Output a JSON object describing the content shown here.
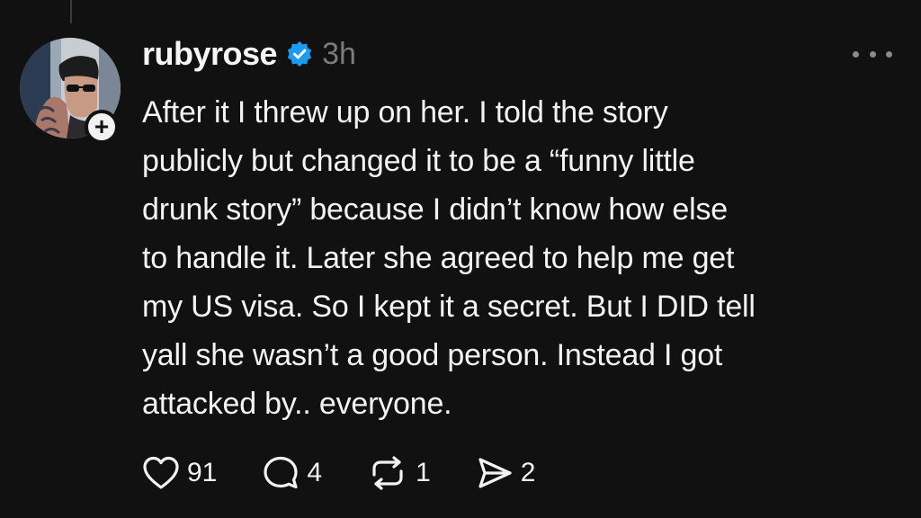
{
  "post": {
    "username": "rubyrose",
    "verified": true,
    "time": "3h",
    "body_lines": [
      "After it I threw up on her. I told the story",
      "publicly but changed it to be a “funny little",
      "drunk story” because I didn’t know how else",
      "to handle it. Later she agreed to help me get",
      "my US visa. So I kept it a secret. But I DID tell",
      "yall she wasn’t a good person. Instead I got",
      "attacked by.. everyone."
    ],
    "actions": {
      "likes": "91",
      "replies": "4",
      "reposts": "1",
      "shares": "2"
    }
  },
  "icons": {
    "add": "plus-icon",
    "verified": "verified-badge-icon",
    "more": "more-horizontal-icon",
    "like": "heart-icon",
    "reply": "comment-icon",
    "repost": "repost-icon",
    "share": "send-icon"
  },
  "colors": {
    "background": "#111111",
    "text": "#f3f3f3",
    "muted": "#7c7c7c",
    "verified": "#1d9bf0"
  }
}
